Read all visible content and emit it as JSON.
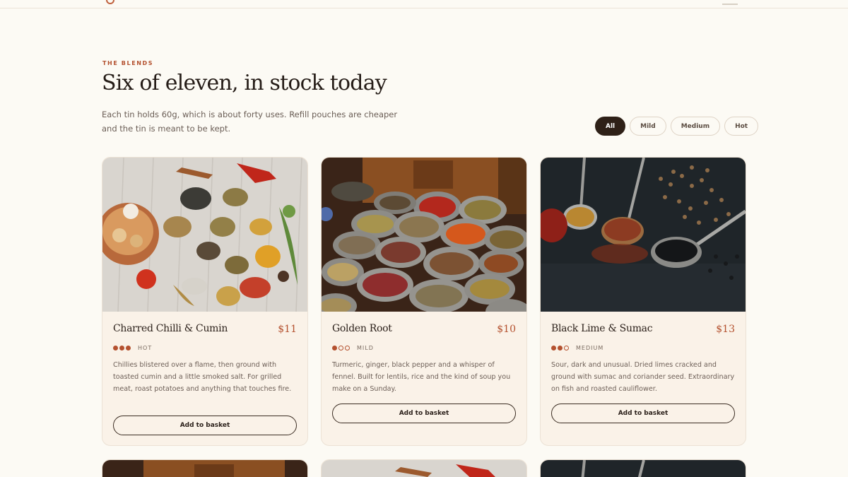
{
  "section": {
    "eyebrow": "THE BLENDS",
    "title": "Six of eleven, in stock today",
    "intro": "Each tin holds 60g, which is about forty uses. Refill pouches are cheaper and the tin is meant to be kept."
  },
  "filters": [
    {
      "label": "All",
      "active": true
    },
    {
      "label": "Mild",
      "active": false
    },
    {
      "label": "Medium",
      "active": false
    },
    {
      "label": "Hot",
      "active": false
    }
  ],
  "products": [
    {
      "name": "Charred Chilli & Cumin",
      "price": "$11",
      "heat_level": 3,
      "heat_label": "HOT",
      "description": "Chillies blistered over a flame, then ground with toasted cumin and a little smoked salt. For grilled meat, roast potatoes and anything that touches fire.",
      "button": "Add to basket"
    },
    {
      "name": "Golden Root",
      "price": "$10",
      "heat_level": 1,
      "heat_label": "MILD",
      "description": "Turmeric, ginger, black pepper and a whisper of fennel. Built for lentils, rice and the kind of soup you make on a Sunday.",
      "button": "Add to basket"
    },
    {
      "name": "Black Lime & Sumac",
      "price": "$13",
      "heat_level": 2,
      "heat_label": "MEDIUM",
      "description": "Sour, dark and unusual. Dried limes cracked and ground with sumac and coriander seed. Extraordinary on fish and roasted cauliflower.",
      "button": "Add to basket"
    }
  ],
  "colors": {
    "accent": "#b4512f",
    "ink": "#2a211c",
    "background": "#fcfaf4",
    "card": "#faf2e8"
  }
}
